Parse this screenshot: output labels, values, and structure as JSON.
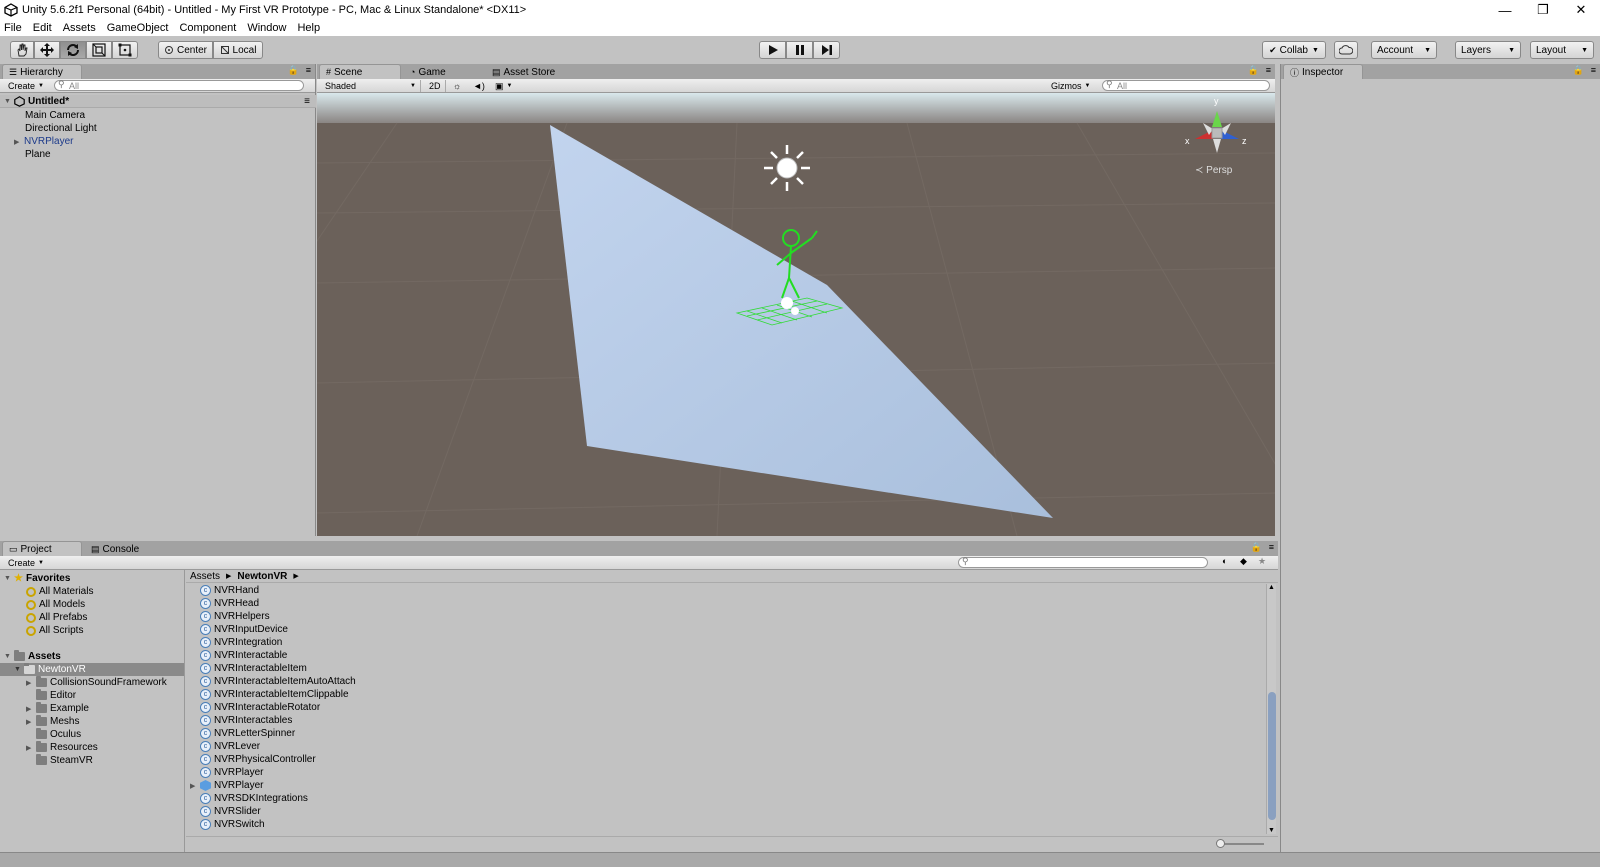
{
  "window": {
    "title": "Unity 5.6.2f1 Personal (64bit) - Untitled - My First VR Prototype - PC, Mac & Linux Standalone* <DX11>",
    "minimize": "—",
    "restore": "❐",
    "close": "✕"
  },
  "menu": [
    "File",
    "Edit",
    "Assets",
    "GameObject",
    "Component",
    "Window",
    "Help"
  ],
  "toolbar": {
    "pivot_label": "Center",
    "space_label": "Local",
    "collab_label": "Collab",
    "account_label": "Account",
    "layers_label": "Layers",
    "layout_label": "Layout"
  },
  "hierarchy": {
    "tab_label": "Hierarchy",
    "create_label": "Create",
    "search_placeholder": "All",
    "scene_name": "Untitled*",
    "items": [
      "Main Camera",
      "Directional Light",
      "NVRPlayer",
      "Plane"
    ]
  },
  "scene_view": {
    "tabs": [
      "Scene",
      "Game",
      "Asset Store"
    ],
    "shading_mode": "Shaded",
    "mode_2d": "2D",
    "gizmos_label": "Gizmos",
    "search_placeholder": "All",
    "persp_label": "Persp",
    "axis_x": "x",
    "axis_y": "y",
    "axis_z": "z"
  },
  "inspector": {
    "tab_label": "Inspector"
  },
  "project": {
    "tabs": [
      "Project",
      "Console"
    ],
    "create_label": "Create",
    "favorites_label": "Favorites",
    "favorites": [
      "All Materials",
      "All Models",
      "All Prefabs",
      "All Scripts"
    ],
    "assets_label": "Assets",
    "selected_folder": "NewtonVR",
    "subfolders": [
      "CollisionSoundFramework",
      "Editor",
      "Example",
      "Meshs",
      "Oculus",
      "Resources",
      "SteamVR"
    ],
    "breadcrumb": [
      "Assets",
      "NewtonVR"
    ],
    "files": [
      "NVRHand",
      "NVRHead",
      "NVRHelpers",
      "NVRInputDevice",
      "NVRIntegration",
      "NVRInteractable",
      "NVRInteractableItem",
      "NVRInteractableItemAutoAttach",
      "NVRInteractableItemClippable",
      "NVRInteractableRotator",
      "NVRInteractables",
      "NVRLetterSpinner",
      "NVRLever",
      "NVRPhysicalController",
      "NVRPlayer",
      "NVRPlayer",
      "NVRSDKIntegrations",
      "NVRSlider",
      "NVRSwitch"
    ]
  },
  "colors": {
    "editor_bg": "#c2c2c2",
    "scene_ground": "#6b615a",
    "plane": "#b4c8e4",
    "selected": "#8a8a8a",
    "prefab_text": "#1c3a8a"
  }
}
